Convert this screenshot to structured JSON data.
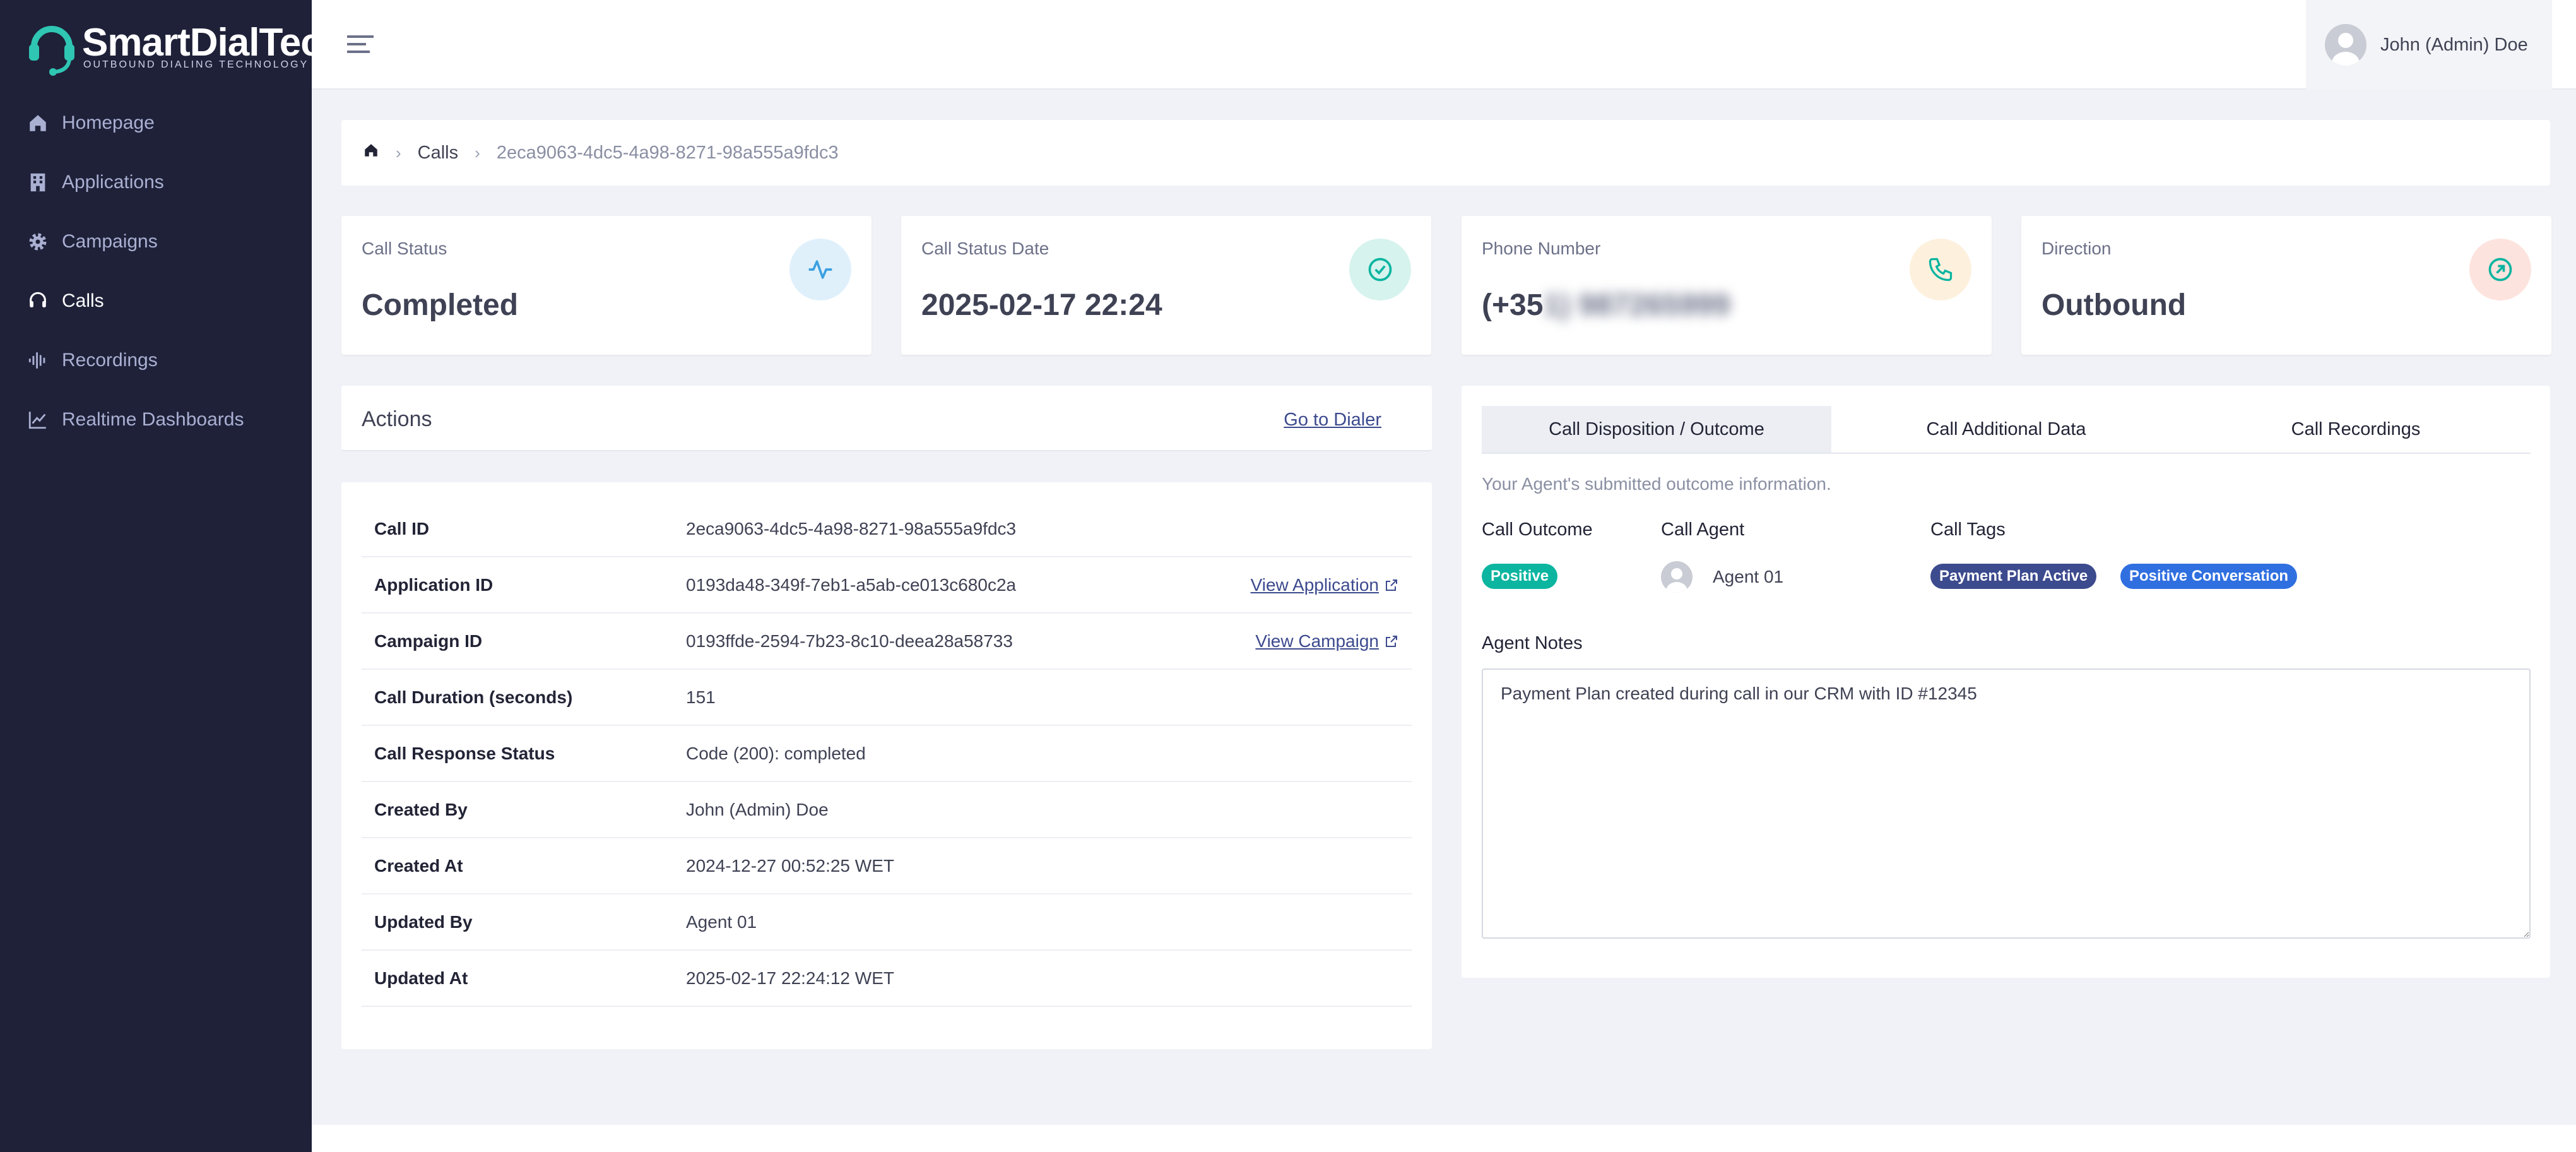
{
  "brand": {
    "name": "SmartDialTech",
    "tagline": "OUTBOUND DIALING TECHNOLOGY",
    "colors": {
      "sidebar": "#1f2139",
      "accent": "#3c4a8e",
      "positive": "#0bb5a0",
      "tag_dark": "#3c4a8e",
      "tag_blue": "#2f6fe0"
    }
  },
  "sidebar": {
    "items": [
      {
        "label": "Homepage",
        "icon": "home-icon",
        "active": false
      },
      {
        "label": "Applications",
        "icon": "building-icon",
        "active": false
      },
      {
        "label": "Campaigns",
        "icon": "gear-icon",
        "active": false
      },
      {
        "label": "Calls",
        "icon": "headset-icon",
        "active": true
      },
      {
        "label": "Recordings",
        "icon": "waveform-icon",
        "active": false
      },
      {
        "label": "Realtime Dashboards",
        "icon": "chart-line-icon",
        "active": false
      }
    ]
  },
  "header": {
    "user_name": "John (Admin) Doe"
  },
  "breadcrumb": {
    "section": "Calls",
    "current": "2eca9063-4dc5-4a98-8271-98a555a9fdc3"
  },
  "stats": [
    {
      "label": "Call Status",
      "value": "Completed",
      "icon": "pulse-icon"
    },
    {
      "label": "Call Status Date",
      "value": "2025-02-17 22:24",
      "icon": "check-circle-icon"
    },
    {
      "label": "Phone Number",
      "value_visible": "(+35",
      "value_blurred": "1) 987265999",
      "icon": "phone-icon"
    },
    {
      "label": "Direction",
      "value": "Outbound",
      "icon": "arrow-circle-icon"
    }
  ],
  "actions": {
    "title": "Actions",
    "dialer_link": "Go to Dialer"
  },
  "details": {
    "rows": [
      {
        "key": "Call ID",
        "value": "2eca9063-4dc5-4a98-8271-98a555a9fdc3"
      },
      {
        "key": "Application ID",
        "value": "0193da48-349f-7eb1-a5ab-ce013c680c2a",
        "link": "View Application"
      },
      {
        "key": "Campaign ID",
        "value": "0193ffde-2594-7b23-8c10-deea28a58733",
        "link": "View Campaign"
      },
      {
        "key": "Call Duration (seconds)",
        "value": "151"
      },
      {
        "key": "Call Response Status",
        "value": "Code (200): completed"
      },
      {
        "key": "Created By",
        "value": "John (Admin) Doe"
      },
      {
        "key": "Created At",
        "value": "2024-12-27 00:52:25 WET"
      },
      {
        "key": "Updated By",
        "value": "Agent 01"
      },
      {
        "key": "Updated At",
        "value": "2025-02-17 22:24:12 WET"
      }
    ]
  },
  "outcome": {
    "tabs": [
      "Call Disposition / Outcome",
      "Call Additional Data",
      "Call Recordings"
    ],
    "active_tab": 0,
    "description": "Your Agent's submitted outcome information.",
    "outcome_header": "Call Outcome",
    "outcome_badge": "Positive",
    "agent_header": "Call Agent",
    "agent_name": "Agent 01",
    "tags_header": "Call Tags",
    "tags": [
      "Payment Plan Active",
      "Positive Conversation"
    ],
    "notes_label": "Agent Notes",
    "notes_value": "Payment Plan created during call in our CRM with ID #12345"
  }
}
